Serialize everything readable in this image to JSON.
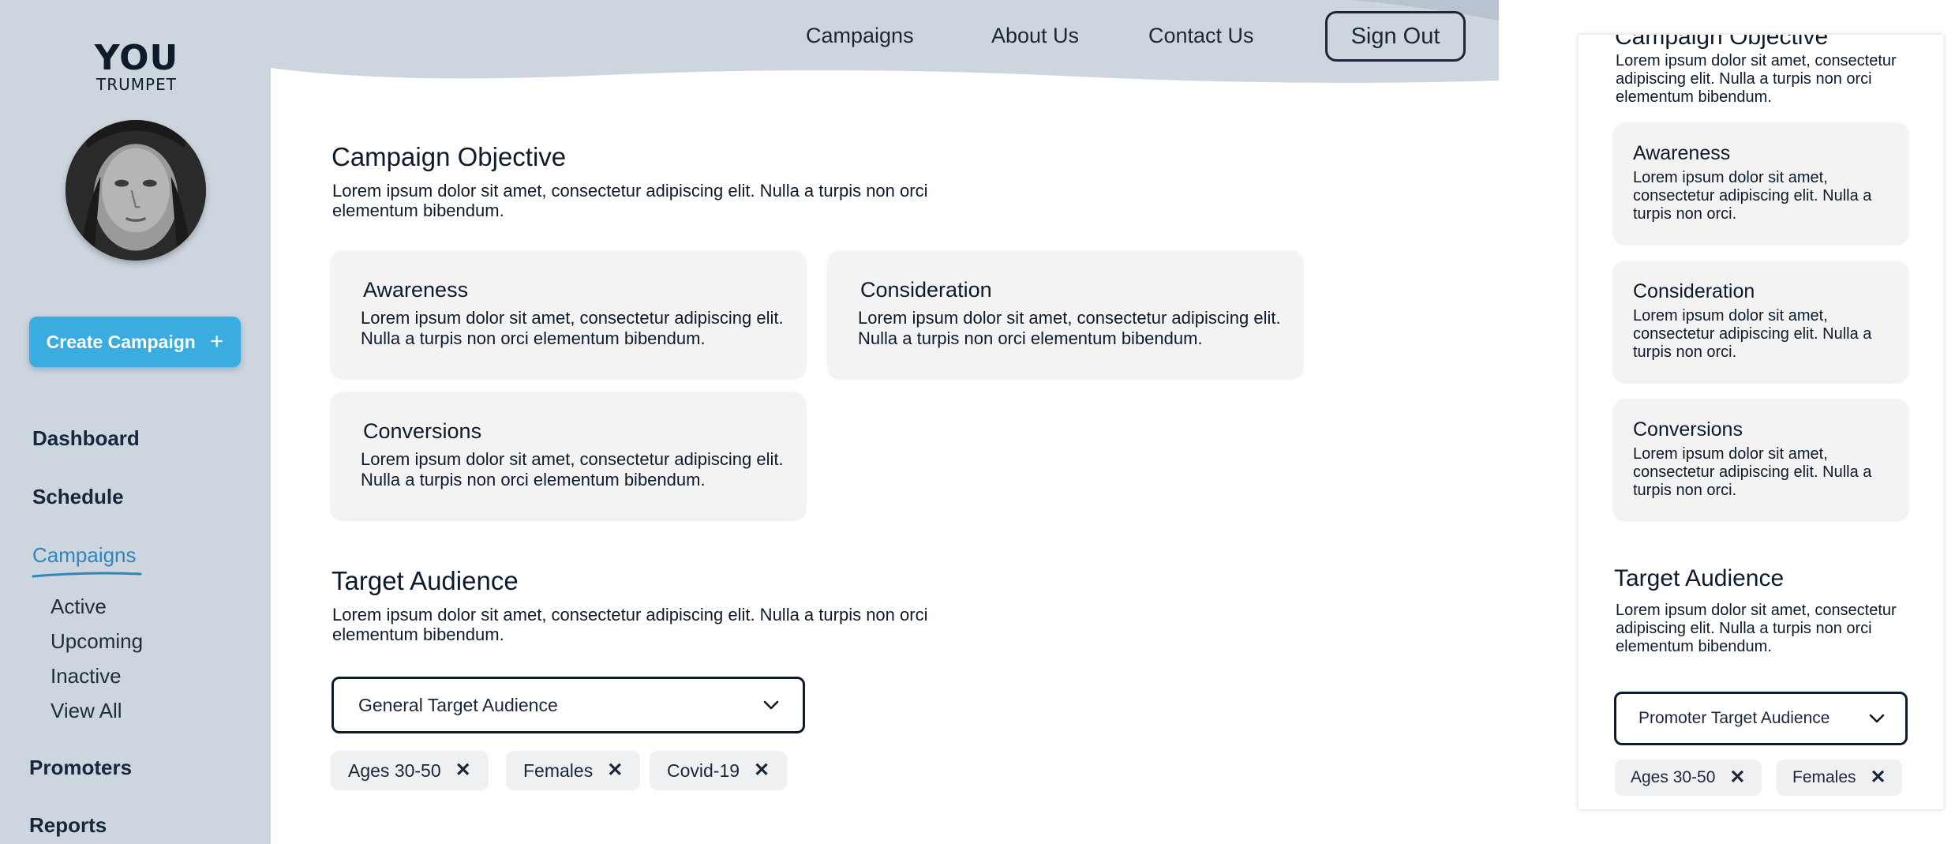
{
  "brand": {
    "logo_top": "YOU",
    "logo_bottom": "TRUMPET"
  },
  "sidebar": {
    "create_button": "Create Campaign",
    "items": [
      {
        "label": "Dashboard"
      },
      {
        "label": "Schedule"
      },
      {
        "label": "Campaigns",
        "active": true
      },
      {
        "label": "Promoters"
      },
      {
        "label": "Reports"
      }
    ],
    "campaign_subitems": [
      "Active",
      "Upcoming",
      "Inactive",
      "View All"
    ]
  },
  "topnav": {
    "links": [
      "Campaigns",
      "About Us",
      "Contact Us"
    ],
    "signout": "Sign Out"
  },
  "objective": {
    "title": "Campaign Objective",
    "description": "Lorem ipsum dolor sit amet, consectetur adipiscing elit. Nulla a turpis non orci elementum bibendum.",
    "cards": [
      {
        "title": "Awareness",
        "text": "Lorem ipsum dolor sit amet, consectetur adipiscing elit. Nulla a turpis non orci elementum bibendum."
      },
      {
        "title": "Consideration",
        "text": "Lorem ipsum dolor sit amet, consectetur adipiscing elit. Nulla a turpis non orci elementum bibendum."
      },
      {
        "title": "Conversions",
        "text": "Lorem ipsum dolor sit amet, consectetur adipiscing elit. Nulla a turpis non orci elementum bibendum."
      }
    ]
  },
  "audience": {
    "title": "Target Audience",
    "description": "Lorem ipsum dolor sit amet, consectetur adipiscing elit. Nulla a turpis non orci elementum bibendum.",
    "dropdown_value": "General Target Audience",
    "chips": [
      "Ages 30-50",
      "Females",
      "Covid-19"
    ]
  },
  "mobile": {
    "cut_title": "Campaign Objective",
    "description": "Lorem ipsum dolor sit amet, consectetur adipiscing elit. Nulla a turpis non orci elementum bibendum.",
    "cards": [
      {
        "title": "Awareness",
        "text": "Lorem ipsum dolor sit amet, consectetur adipiscing elit. Nulla a turpis non orci."
      },
      {
        "title": "Consideration",
        "text": "Lorem ipsum dolor sit amet, consectetur adipiscing elit. Nulla a turpis non orci."
      },
      {
        "title": "Conversions",
        "text": "Lorem ipsum dolor sit amet, consectetur adipiscing elit. Nulla a turpis non orci."
      }
    ],
    "audience_title": "Target Audience",
    "audience_description": "Lorem ipsum dolor sit amet, consectetur adipiscing elit. Nulla a turpis non orci elementum bibendum.",
    "dropdown_value": "Promoter Target Audience",
    "chips": [
      "Ages 30-50",
      "Females"
    ]
  },
  "colors": {
    "sidebar_bg": "#cdd5df",
    "accent": "#3aace0",
    "active_nav": "#2f86bd",
    "text": "#0d1b2a",
    "card_bg": "#f3f3f3"
  },
  "icons": {
    "create": "plus-icon",
    "dropdown": "chevron-down-icon",
    "chip_remove": "close-icon"
  }
}
